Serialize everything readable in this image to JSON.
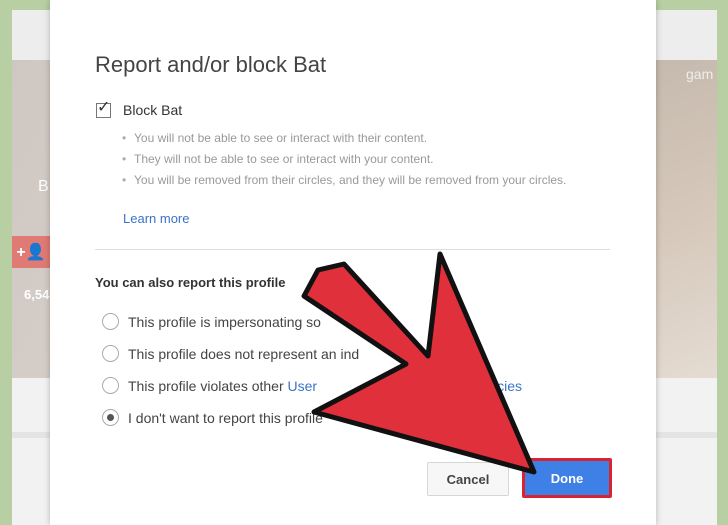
{
  "background": {
    "left_letter": "B",
    "follow_icon": "+👤",
    "count": "6,54",
    "right_text": "gam"
  },
  "dialog": {
    "title": "Report and/or block Bat",
    "block": {
      "label": "Block Bat",
      "checked": true,
      "bullets": [
        "You will not be able to see or interact with their content.",
        "They will not be able to see or interact with your content.",
        "You will be removed from their circles, and they will be removed from your circles."
      ],
      "learn_more": "Learn more"
    },
    "report": {
      "heading": "You can also report this profile",
      "options": [
        {
          "text": "This profile is impersonating so",
          "checked": false
        },
        {
          "text": "This profile does not represent an ind",
          "checked": false
        },
        {
          "text_before": "This profile violates other ",
          "link_start": "User",
          "link_end": "cies",
          "checked": false
        },
        {
          "text": "I don't want to report this profile",
          "checked": true
        }
      ]
    },
    "buttons": {
      "cancel": "Cancel",
      "done": "Done"
    }
  },
  "colors": {
    "link": "#3b73c8",
    "done_bg": "#3f80e6",
    "arrow_red": "#e0303c"
  }
}
